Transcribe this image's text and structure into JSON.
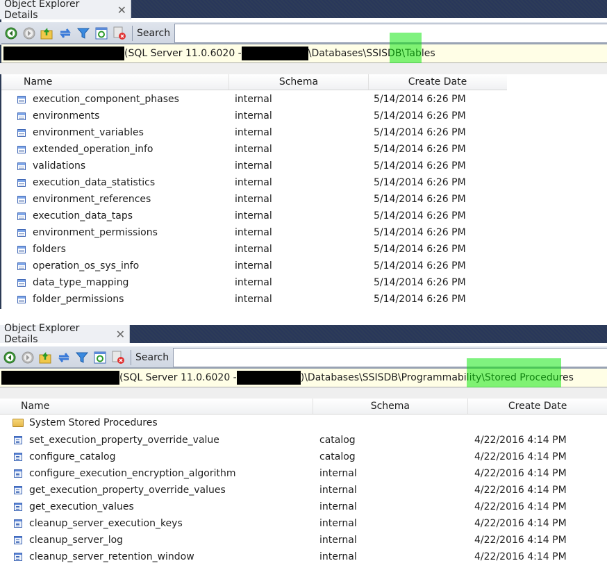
{
  "panels": [
    {
      "tab": {
        "title": "Object Explorer Details",
        "close": "✕"
      },
      "toolbar": {
        "icons": [
          "back-icon",
          "forward-icon",
          "up-folder-icon",
          "sync-icon",
          "filter-icon",
          "refresh-icon",
          "stop-script-icon"
        ],
        "search_label": "Search",
        "search_value": ""
      },
      "path": {
        "server_redacted": "",
        "server_info": "(SQL Server 11.0.6020 - ",
        "user_redacted": "",
        "path_text": "\\Databases\\SSISDB\\",
        "current_node": "Tables",
        "highlight_color": "#00e600"
      },
      "columns": [
        "Name",
        "Schema",
        "Create Date"
      ],
      "rows": [
        {
          "name": "execution_component_phases",
          "schema": "internal",
          "date": "5/14/2014 6:26 PM"
        },
        {
          "name": "environments",
          "schema": "internal",
          "date": "5/14/2014 6:26 PM"
        },
        {
          "name": "environment_variables",
          "schema": "internal",
          "date": "5/14/2014 6:26 PM"
        },
        {
          "name": "extended_operation_info",
          "schema": "internal",
          "date": "5/14/2014 6:26 PM"
        },
        {
          "name": "validations",
          "schema": "internal",
          "date": "5/14/2014 6:26 PM"
        },
        {
          "name": "execution_data_statistics",
          "schema": "internal",
          "date": "5/14/2014 6:26 PM"
        },
        {
          "name": "environment_references",
          "schema": "internal",
          "date": "5/14/2014 6:26 PM"
        },
        {
          "name": "execution_data_taps",
          "schema": "internal",
          "date": "5/14/2014 6:26 PM"
        },
        {
          "name": "environment_permissions",
          "schema": "internal",
          "date": "5/14/2014 6:26 PM"
        },
        {
          "name": "folders",
          "schema": "internal",
          "date": "5/14/2014 6:26 PM"
        },
        {
          "name": "operation_os_sys_info",
          "schema": "internal",
          "date": "5/14/2014 6:26 PM"
        },
        {
          "name": "data_type_mapping",
          "schema": "internal",
          "date": "5/14/2014 6:26 PM"
        },
        {
          "name": "folder_permissions",
          "schema": "internal",
          "date": "5/14/2014 6:26 PM"
        }
      ]
    },
    {
      "tab": {
        "title": "Object Explorer Details",
        "close": "✕"
      },
      "toolbar": {
        "icons": [
          "back-icon",
          "forward-icon",
          "up-folder-icon",
          "sync-icon",
          "filter-icon",
          "refresh-icon",
          "stop-script-icon"
        ],
        "search_label": "Search",
        "search_value": ""
      },
      "path": {
        "server_redacted": "",
        "server_info": "(SQL Server 11.0.6020 - ",
        "user_redacted": "",
        "path_text": ")\\Databases\\SSISDB\\Programmability\\",
        "current_node": "Stored Procedures",
        "highlight_color": "#00e600"
      },
      "columns": [
        "Name",
        "Schema",
        "Create Date"
      ],
      "folder": {
        "name": "System Stored Procedures"
      },
      "rows": [
        {
          "name": "set_execution_property_override_value",
          "schema": "catalog",
          "date": "4/22/2016 4:14 PM"
        },
        {
          "name": "configure_catalog",
          "schema": "catalog",
          "date": "4/22/2016 4:14 PM"
        },
        {
          "name": "configure_execution_encryption_algorithm",
          "schema": "internal",
          "date": "4/22/2016 4:14 PM"
        },
        {
          "name": "get_execution_property_override_values",
          "schema": "internal",
          "date": "4/22/2016 4:14 PM"
        },
        {
          "name": "get_execution_values",
          "schema": "internal",
          "date": "4/22/2016 4:14 PM"
        },
        {
          "name": "cleanup_server_execution_keys",
          "schema": "internal",
          "date": "4/22/2016 4:14 PM"
        },
        {
          "name": "cleanup_server_log",
          "schema": "internal",
          "date": "4/22/2016 4:14 PM"
        },
        {
          "name": "cleanup_server_retention_window",
          "schema": "internal",
          "date": "4/22/2016 4:14 PM"
        }
      ]
    }
  ]
}
